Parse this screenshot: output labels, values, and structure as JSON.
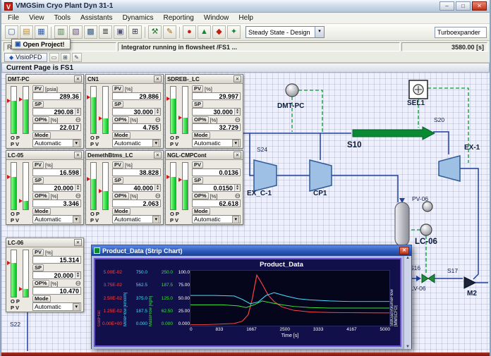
{
  "window": {
    "title": "VMGSim Cryo Plant Dyn 31-1",
    "controls": {
      "minimize": "–",
      "maximize": "□",
      "close": "✕"
    }
  },
  "menu": [
    "File",
    "View",
    "Tools",
    "Assistants",
    "Dynamics",
    "Reporting",
    "Window",
    "Help"
  ],
  "toolbar": {
    "icons": [
      {
        "name": "new-case-icon",
        "glyph": "▢",
        "color": "#3a5fa8"
      },
      {
        "name": "open-case-icon",
        "glyph": "▤",
        "color": "#c28a1e"
      },
      {
        "name": "save-case-icon",
        "glyph": "▦",
        "color": "#2f5fb0"
      },
      {
        "name": "workbook-icon",
        "glyph": "▥",
        "color": "#4a7a4a"
      },
      {
        "name": "pfd-view-icon",
        "glyph": "▧",
        "color": "#6a4a8a"
      },
      {
        "name": "summary-table-icon",
        "glyph": "▩",
        "color": "#3a5a7a"
      },
      {
        "name": "report-icon",
        "glyph": "≣",
        "color": "#444444"
      },
      {
        "name": "pages-icon",
        "glyph": "▣",
        "color": "#555577"
      },
      {
        "name": "calculator-icon",
        "glyph": "⊞",
        "color": "#333344"
      },
      {
        "name": "tools-icon",
        "glyph": "⚒",
        "color": "#1e7a1e"
      },
      {
        "name": "edit-icon",
        "glyph": "✎",
        "color": "#a05f10"
      },
      {
        "name": "stop-integrator-icon",
        "glyph": "●",
        "color": "#c41e10"
      },
      {
        "name": "run-integrator-icon",
        "glyph": "▲",
        "color": "#0e8a2e"
      },
      {
        "name": "hold-integrator-icon",
        "glyph": "◆",
        "color": "#c41e10"
      },
      {
        "name": "reset-integrator-icon",
        "glyph": "✦",
        "color": "#0e8a2e"
      }
    ],
    "mode_select": {
      "value": "Steady State - Design"
    },
    "unit_box": {
      "value": "Turboexpander"
    }
  },
  "status": {
    "left": "Re",
    "popup": "Open Project!",
    "center": "Integrator running in flowsheet /FS1 ...",
    "time": "3580.00 [s]"
  },
  "pfd_bar": {
    "tab": "VisioPFD",
    "icons": [
      {
        "name": "pfd-page-icon",
        "glyph": "▭"
      },
      {
        "name": "pfd-add-icon",
        "glyph": "⊞"
      },
      {
        "name": "pfd-edit-icon",
        "glyph": "✎"
      }
    ]
  },
  "page_bar": {
    "text": "Current Page is FS1"
  },
  "faceplates": [
    {
      "title": "DMT-PC",
      "pv_label": "PV",
      "pv_unit": "[psia]",
      "pv_value": "289.36",
      "sp_label": "SP",
      "sp_value": "290.08",
      "op_label": "OP%",
      "op_unit": "[%]",
      "op_value": "22.017",
      "mode_label": "Mode",
      "mode_value": "Automatic",
      "gauge_caption": "OP PV",
      "op_bar_pct": 70,
      "pv_bar_pct": 72
    },
    {
      "title": "CN1",
      "pv_label": "PV",
      "pv_unit": "[%]",
      "pv_value": "29.886",
      "sp_label": "SP",
      "sp_value": "30.000",
      "op_label": "OP%",
      "op_unit": "[%]",
      "op_value": "4.765",
      "mode_label": "Mode",
      "mode_value": "Automatic",
      "gauge_caption": "OP PV",
      "op_bar_pct": 78,
      "pv_bar_pct": 32
    },
    {
      "title": "SDREB-_LC",
      "pv_label": "PV",
      "pv_unit": "[%]",
      "pv_value": "29.997",
      "sp_label": "SP",
      "sp_value": "30.000",
      "op_label": "OP%",
      "op_unit": "[%]",
      "op_value": "32.729",
      "mode_label": "Mode",
      "mode_value": "Automatic",
      "gauge_caption": "OP PV",
      "op_bar_pct": 75,
      "pv_bar_pct": 33
    },
    {
      "title": "LC-05",
      "pv_label": "PV",
      "pv_unit": "[%]",
      "pv_value": "16.598",
      "sp_label": "SP",
      "sp_value": "20.000",
      "op_label": "OP%",
      "op_unit": "[%]",
      "op_value": "3.346",
      "mode_label": "Mode",
      "mode_value": "Automatic",
      "gauge_caption": "OP PV",
      "op_bar_pct": 70,
      "pv_bar_pct": 18
    },
    {
      "title": "DemethBtms_LC",
      "pv_label": "PV",
      "pv_unit": "[%]",
      "pv_value": "38.828",
      "sp_label": "SP",
      "sp_value": "40.000",
      "op_label": "OP%",
      "op_unit": "[%]",
      "op_value": "2.063",
      "mode_label": "Mode",
      "mode_value": "Automatic",
      "gauge_caption": "OP PV",
      "op_bar_pct": 65,
      "pv_bar_pct": 40
    },
    {
      "title": "NGL-CMPCont",
      "pv_label": "PV",
      "pv_unit": "",
      "pv_value": "0.0136",
      "sp_label": "SP",
      "sp_value": "0.0150",
      "op_label": "OP%",
      "op_unit": "[%]",
      "op_value": "62.618",
      "mode_label": "Mode",
      "mode_value": "Automatic",
      "gauge_caption": "OP PV",
      "op_bar_pct": 70,
      "pv_bar_pct": 64
    },
    {
      "title": "LC-06",
      "pv_label": "PV",
      "pv_unit": "[%]",
      "pv_value": "15.314",
      "sp_label": "SP",
      "sp_value": "20.000",
      "op_label": "OP%",
      "op_unit": "[%]",
      "op_value": "10.470",
      "mode_label": "Mode",
      "mode_value": "Automatic",
      "gauge_caption": "OP PV",
      "op_bar_pct": 72,
      "pv_bar_pct": 16
    }
  ],
  "pfd": {
    "labels": {
      "dmt_pc": "DMT-PC",
      "sel1": "SEL1",
      "s20": "S20",
      "s10": "S10",
      "s24": "S24",
      "ex_c_1": "EX_C-1",
      "cp1": "CP1",
      "ex_1": "EX-1",
      "pv_06": "PV-06",
      "lc_06": "LC-06",
      "s16": "S16",
      "lv_06": "LV-06",
      "s17": "S17",
      "m2": "M2",
      "s22": "S22"
    }
  },
  "strip_chart": {
    "window_title": "Product_Data (Strip Chart)",
    "title": "Product_Data",
    "axes": [
      {
        "label": "GasFrac",
        "color": "#ff4545",
        "ticks": [
          "5.00E-02",
          "3.75E-02",
          "2.50E-02",
          "1.25E-02",
          "0.00E+00"
        ]
      },
      {
        "label": "MoleFlow [kmol/h]",
        "color": "#4adcff",
        "ticks": [
          "750.0",
          "562.5",
          "375.0",
          "187.5",
          "0.000"
        ]
      },
      {
        "label": "MassFlow [kg/h]",
        "color": "#39e639",
        "ticks": [
          "250.0",
          "187.5",
          "125.0",
          "62.50",
          "0.000"
        ]
      },
      {
        "label": "",
        "color": "#ffffff",
        "ticks": [
          "100.0",
          "75.00",
          "50.00",
          "25.00",
          "0.000"
        ]
      }
    ],
    "right_axis_label": "StdGasVolumeFlow [MMSCFD]",
    "x_ticks": [
      "0",
      "833",
      "1667",
      "2500",
      "3333",
      "4167",
      "5000"
    ],
    "x_label": "Time [s]"
  },
  "chart_data": {
    "type": "line",
    "title": "Product_Data",
    "xlabel": "Time [s]",
    "xlim": [
      0,
      5000
    ],
    "x_tick_values": [
      0,
      833,
      1667,
      2500,
      3333,
      4167,
      5000
    ],
    "legend_position": "none",
    "grid": false,
    "series": [
      {
        "name": "GasFrac",
        "color": "#ff4545",
        "ylim": [
          0,
          0.05
        ],
        "x": [
          0,
          400,
          800,
          1100,
          1300,
          1450,
          1550,
          1667,
          1800,
          1950,
          2100,
          2300,
          2600,
          3000,
          3500,
          4000,
          4500,
          5000
        ],
        "y": [
          0.001,
          0.001,
          0.0015,
          0.002,
          0.004,
          0.01,
          0.024,
          0.046,
          0.038,
          0.028,
          0.022,
          0.017,
          0.014,
          0.0125,
          0.012,
          0.0118,
          0.0117,
          0.0116
        ]
      },
      {
        "name": "StdGasVolumeFlow",
        "color": "#4adcff",
        "ylim": [
          0,
          100
        ],
        "x": [
          0,
          600,
          1100,
          1300,
          1500,
          1700,
          1900,
          2100,
          2400,
          2700,
          3000,
          3500,
          4000,
          5000
        ],
        "y": [
          55,
          55,
          54,
          48,
          40,
          43,
          55,
          60,
          54,
          49,
          47,
          45,
          44,
          44
        ]
      },
      {
        "name": "MassFlow",
        "color": "#39e639",
        "ylim": [
          0,
          100
        ],
        "x": [
          0,
          800,
          1200,
          1400,
          1600,
          1800,
          2000,
          2300,
          2600,
          3000,
          3500,
          4000,
          5000
        ],
        "y": [
          38,
          38,
          36,
          33,
          38,
          45,
          42,
          38,
          35,
          33,
          32,
          32,
          32
        ]
      }
    ]
  }
}
